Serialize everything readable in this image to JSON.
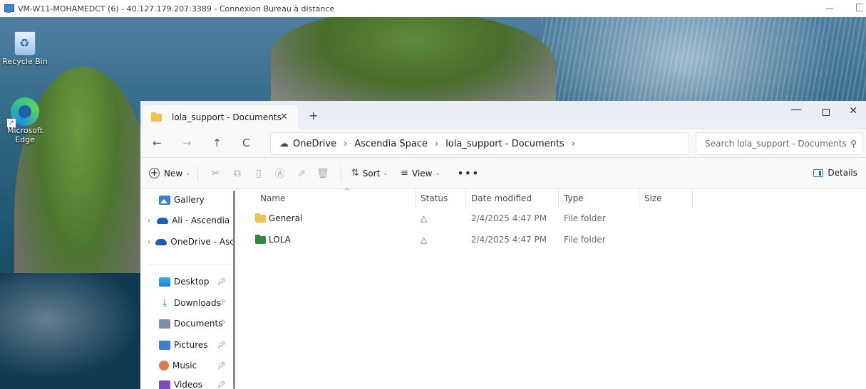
{
  "rdp": {
    "title": "VM-W11-MOHAMEDCT (6) - 40.127.179.207:3389 - Connexion Bureau à distance"
  },
  "desktop": {
    "icons": [
      {
        "label": "Recycle Bin"
      },
      {
        "label": "Microsoft Edge"
      }
    ]
  },
  "explorer": {
    "tab": {
      "label": "lola_support - Documents"
    },
    "nav": {
      "back": "←",
      "forward": "→",
      "up": "↑",
      "refresh": "C"
    },
    "breadcrumb": [
      "OneDrive",
      "Ascendia Space",
      "lola_support - Documents"
    ],
    "search": {
      "placeholder": "Search lola_support - Documents"
    },
    "toolbar": {
      "new_label": "New",
      "sort_label": "Sort",
      "view_label": "View",
      "more_label": "•••",
      "details_label": "Details"
    },
    "sidebar": {
      "items": [
        {
          "label": "Gallery",
          "icon": "gallery-icon"
        },
        {
          "label": "Ali - Ascendia Space",
          "icon": "onedrive-icon"
        },
        {
          "label": "OneDrive - Ascendia Space",
          "icon": "onedrive-icon"
        },
        {
          "label": "Desktop",
          "icon": "desktop-folder-icon"
        },
        {
          "label": "Downloads",
          "icon": "downloads-icon"
        },
        {
          "label": "Documents",
          "icon": "documents-icon"
        },
        {
          "label": "Pictures",
          "icon": "pictures-icon"
        },
        {
          "label": "Music",
          "icon": "music-icon"
        },
        {
          "label": "Videos",
          "icon": "videos-icon"
        }
      ]
    },
    "columns": [
      "Name",
      "Status",
      "Date modified",
      "Type",
      "Size"
    ],
    "files": [
      {
        "name": "General",
        "status": "cloud",
        "date": "2/4/2025 4:47 PM",
        "type": "File folder",
        "size": "",
        "folder_color": "#f0c24b"
      },
      {
        "name": "LOLA",
        "status": "cloud",
        "date": "2/4/2025 4:47 PM",
        "type": "File folder",
        "size": "",
        "folder_color": "#2e8b3c"
      }
    ],
    "colors": {
      "accent": "#2a6fb8",
      "general_folder": "#f0c24b",
      "lola_folder": "#2e8b3c"
    }
  }
}
